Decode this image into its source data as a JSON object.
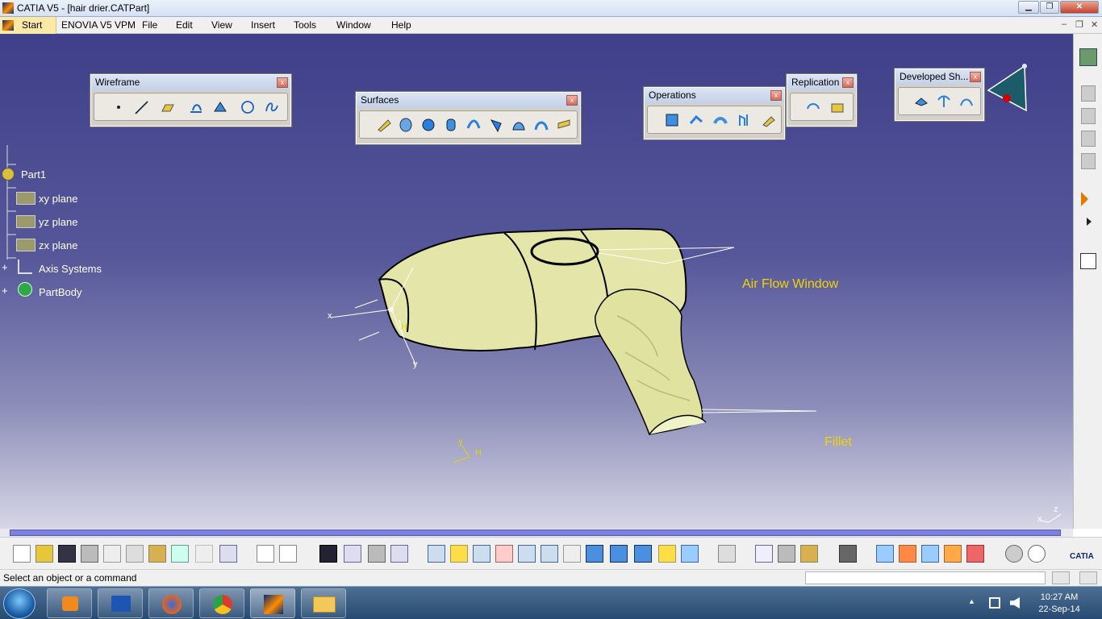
{
  "window": {
    "title": "CATIA V5 - [hair drier.CATPart]",
    "minimize": "▁",
    "maximize": "❐",
    "close": "✕"
  },
  "menu": {
    "start": "Start",
    "enovia": "ENOVIA V5 VPM",
    "file": "File",
    "edit": "Edit",
    "view": "View",
    "insert": "Insert",
    "tools": "Tools",
    "window": "Window",
    "help": "Help",
    "doc_min": "–",
    "doc_restore": "❐",
    "doc_close": "✕"
  },
  "toolbars": {
    "wireframe": {
      "title": "Wireframe",
      "close": "x",
      "icons": [
        "point-icon",
        "line-icon",
        "plane-icon",
        "projection-icon",
        "intersection-icon",
        "circle-icon",
        "spline-icon"
      ]
    },
    "surfaces": {
      "title": "Surfaces",
      "close": "x",
      "icons": [
        "extrude-icon",
        "revolve-icon",
        "sphere-icon",
        "cylinder-icon",
        "offset-icon",
        "sweep-icon",
        "fill-icon",
        "multisection-icon",
        "blend-icon"
      ]
    },
    "operations": {
      "title": "Operations",
      "close": "x",
      "icons": [
        "join-icon",
        "split-icon",
        "fillet-icon",
        "transform-icon",
        "extrapolate-icon"
      ]
    },
    "replication": {
      "title": "Replication",
      "close": "x",
      "icons": [
        "repeat-icon",
        "pattern-icon"
      ]
    },
    "developed": {
      "title": "Developed Sh...",
      "close": "x",
      "icons": [
        "develop-icon",
        "unfold-icon",
        "transfer-icon"
      ]
    }
  },
  "tree": {
    "root": "Part1",
    "items": [
      "xy plane",
      "yz plane",
      "zx plane",
      "Axis Systems",
      "PartBody"
    ]
  },
  "annotations": {
    "air_flow": "Air Flow Window",
    "fillet": "Fillet"
  },
  "axes": {
    "x": "x",
    "y": "y",
    "h": "H",
    "z": "z"
  },
  "status": {
    "text": "Select an object or a command"
  },
  "taskbar": {
    "time": "10:27 AM",
    "date": "22-Sep-14",
    "tray_arrow": "▲"
  },
  "brand": {
    "logo": "CATIA"
  },
  "colors": {
    "viewport_top": "#3f3f8a",
    "viewport_bottom": "#d6d6e6",
    "model": "#e3e6a8",
    "annotation": "#f2d400",
    "wireframe": "#ffffff"
  }
}
